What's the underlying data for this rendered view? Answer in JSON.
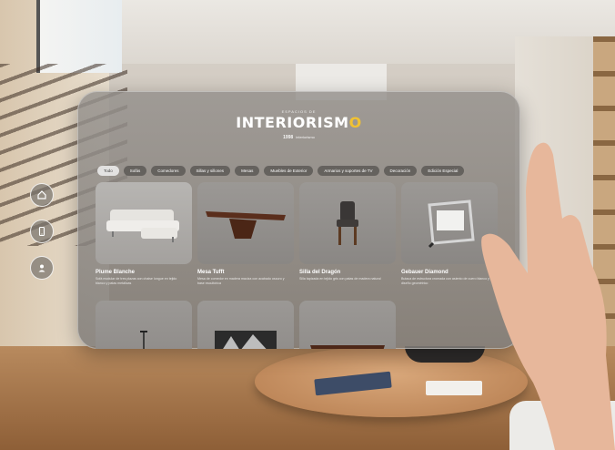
{
  "brand": {
    "sub": "ESPACIOS DE",
    "title_main": "INTERIORISM",
    "title_accent": "O",
    "tag_strong": "1998",
    "tag_text": "interiorismo"
  },
  "dock": {
    "items": [
      {
        "icon": "home-icon"
      },
      {
        "icon": "phone-icon"
      },
      {
        "icon": "user-icon"
      }
    ]
  },
  "categories": [
    {
      "label": "Todo",
      "active": true
    },
    {
      "label": "Sofás",
      "active": false
    },
    {
      "label": "Comedores",
      "active": false
    },
    {
      "label": "Sillas y sillones",
      "active": false
    },
    {
      "label": "Mesas",
      "active": false
    },
    {
      "label": "Muebles de Exterior",
      "active": false
    },
    {
      "label": "Armarios y soportes de TV",
      "active": false
    },
    {
      "label": "Decoración",
      "active": false
    },
    {
      "label": "Edición Especial",
      "active": false
    }
  ],
  "products": [
    {
      "title": "Plume Blanche",
      "desc": "Sofá modular de tres plazas con chaise longue en tejido blanco y patas metálicas",
      "kind": "sofa"
    },
    {
      "title": "Mesa Tufft",
      "desc": "Mesa de comedor en madera maciza con acabado oscuro y base escultórica",
      "kind": "table"
    },
    {
      "title": "Silla del Dragón",
      "desc": "Silla tapizada en tejido gris con patas de madera natural",
      "kind": "chair"
    },
    {
      "title": "Gebauer Diamond",
      "desc": "Butaca de estructura cromada con asiento de cuero blanco y diseño geométrico",
      "kind": "armchair"
    },
    {
      "title": "",
      "desc": "",
      "kind": "lamp"
    },
    {
      "title": "",
      "desc": "",
      "kind": "art"
    },
    {
      "title": "",
      "desc": "",
      "kind": "table2"
    }
  ]
}
